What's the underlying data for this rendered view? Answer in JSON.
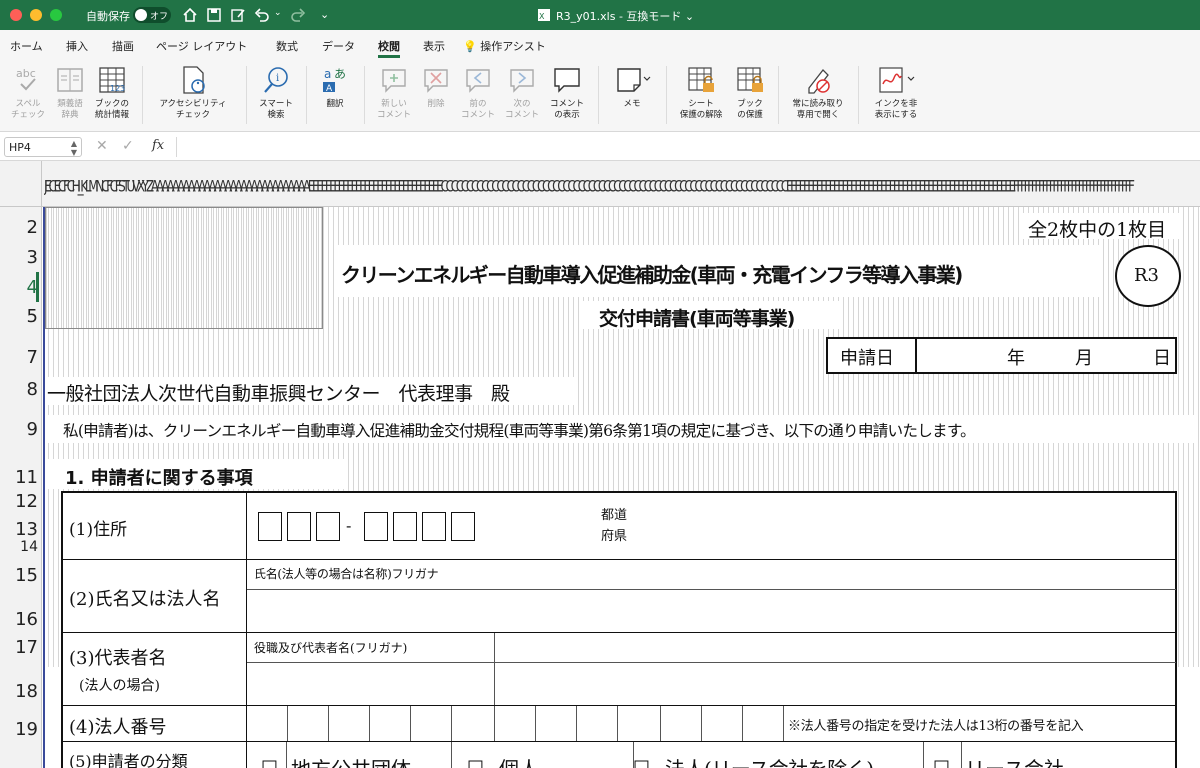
{
  "titlebar": {
    "autosave_label": "自動保存",
    "autosave_state": "オフ",
    "filename": "R3_y01.xls",
    "mode": "互換モード"
  },
  "tabs": [
    "ホーム",
    "挿入",
    "描画",
    "ページ レイアウト",
    "数式",
    "データ",
    "校閲",
    "表示",
    "操作アシスト"
  ],
  "active_tab": "校閲",
  "ribbon": [
    {
      "label": "スペル\nチェック",
      "icon": "spellcheck-icon",
      "disabled": true
    },
    {
      "label": "類義語\n辞典",
      "icon": "thesaurus-icon",
      "disabled": true
    },
    {
      "label": "ブックの\n統計情報",
      "icon": "workbook-statistics-icon",
      "disabled": false
    },
    {
      "label": "アクセシビリティ\nチェック",
      "icon": "accessibility-icon",
      "disabled": false
    },
    {
      "label": "スマート\n検索",
      "icon": "smart-lookup-icon",
      "disabled": false
    },
    {
      "label": "翻訳",
      "icon": "translate-icon",
      "disabled": false
    },
    {
      "label": "新しい\nコメント",
      "icon": "new-comment-icon",
      "disabled": true
    },
    {
      "label": "削除",
      "icon": "delete-comment-icon",
      "disabled": true
    },
    {
      "label": "前の\nコメント",
      "icon": "previous-comment-icon",
      "disabled": true
    },
    {
      "label": "次の\nコメント",
      "icon": "next-comment-icon",
      "disabled": true
    },
    {
      "label": "コメント\nの表示",
      "icon": "show-comments-icon",
      "disabled": false
    },
    {
      "label": "メモ",
      "icon": "notes-icon",
      "disabled": false
    },
    {
      "label": "シート\n保護の解除",
      "icon": "unprotect-sheet-icon",
      "disabled": false
    },
    {
      "label": "ブック\nの保護",
      "icon": "protect-workbook-icon",
      "disabled": false
    },
    {
      "label": "常に読み取り\n専用で開く",
      "icon": "always-read-only-icon",
      "disabled": false
    },
    {
      "label": "インクを非\n表示にする",
      "icon": "hide-ink-icon",
      "disabled": false
    }
  ],
  "formula_bar": {
    "name_box": "HP4",
    "fx": "fx",
    "value": ""
  },
  "column_header_text": "JECECFCHI_KLMNCFCFSTUVXYZAAAAAAAAAAAAAAAAAAAAAAAAAAAAAAEEEEEEEEEEEEEEEEEEEEEEEEEEEEEEECCCCCCCCCCCCCCCCCCCCCCCCCCCCCCCCCCCCCCCCCCCCCCCCCCCCCCCCCCCCCCCCCCCCEEEEEEEEEEEEEEEEEEEEEEEEEEEEEEEEEEEEEEEEEEEEEEEEEEEEEFFFFFFFFFFFFFFFFFFFFFFFFFFFFFFFFF",
  "row_numbers": [
    "2",
    "3",
    "4",
    "5",
    "7",
    "8",
    "9",
    "11",
    "12",
    "13",
    "14",
    "15",
    "16",
    "17",
    "18",
    "19"
  ],
  "form": {
    "page_info": "全2枚中の1枚目",
    "title": "クリーンエネルギー自動車導入促進補助金(車両・充電インフラ等導入事業)",
    "stamp": "R3",
    "subtitle": "交付申請書(車両等事業)",
    "date_label": "申請日",
    "year": "年",
    "month": "月",
    "day": "日",
    "addressee": "一般社団法人次世代自動車振興センター　代表理事　殿",
    "statement": "私(申請者)は、クリーンエネルギー自動車導入促進補助金交付規程(車両等事業)第6条第1項の規定に基づき、以下の通り申請いたします。",
    "section1": "1. 申請者に関する事項",
    "item1": "(1)住所",
    "prefecture": "都道\n府県",
    "postal_sep": "-",
    "item2": "(2)氏名又は法人名",
    "name_hint": "氏名(法人等の場合は名称)フリガナ",
    "item3": "(3)代表者名",
    "item3_note": "(法人の場合)",
    "rep_hint": "役職及び代表者名(フリガナ)",
    "item4": "(4)法人番号",
    "corp_note": "※法人番号の指定を受けた法人は13桁の番号を記入",
    "item5": "(5)申請者の分類",
    "categories": [
      "地方公共団体",
      "個人",
      "法人(リース会社を除く)",
      "リース会社"
    ]
  }
}
